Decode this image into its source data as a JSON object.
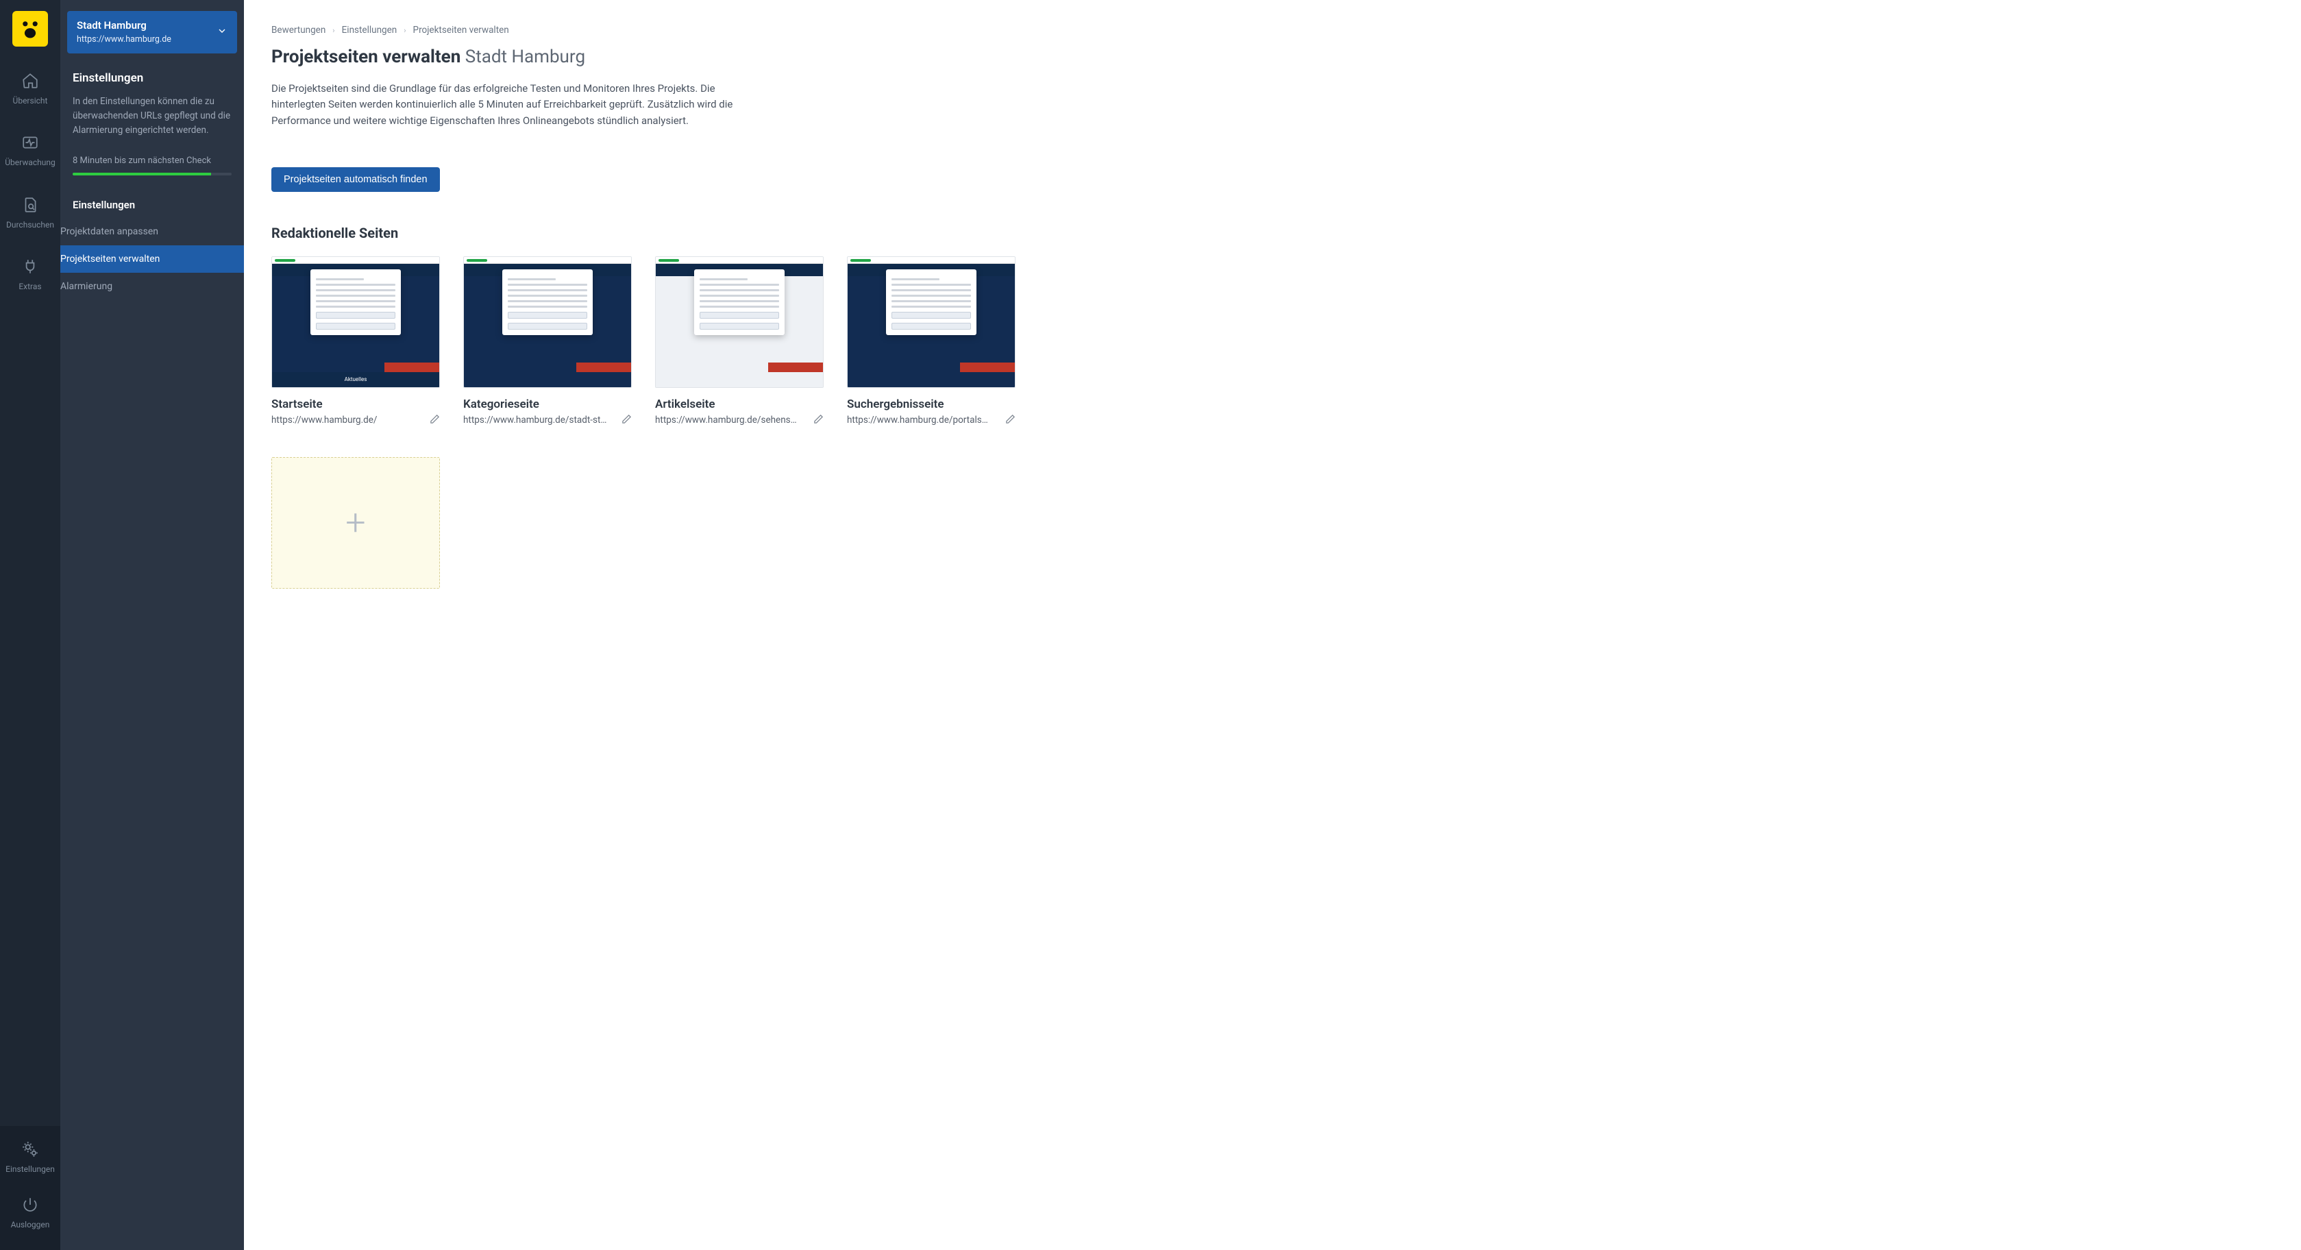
{
  "rail": {
    "items": [
      {
        "id": "overview",
        "label": "Übersicht"
      },
      {
        "id": "monitoring",
        "label": "Überwachung"
      },
      {
        "id": "crawl",
        "label": "Durchsuchen"
      },
      {
        "id": "extras",
        "label": "Extras"
      }
    ],
    "bottom": [
      {
        "id": "settings",
        "label": "Einstellungen"
      },
      {
        "id": "logout",
        "label": "Ausloggen"
      }
    ]
  },
  "project": {
    "name": "Stadt Hamburg",
    "url": "https://www.hamburg.de"
  },
  "side": {
    "heading": "Einstellungen",
    "description": "In den Einstellungen können die zu überwachenden URLs gepflegt und die Alarmierung eingerichtet werden.",
    "checkLine": "8 Minuten bis zum nächsten Check",
    "progressPercent": 87,
    "subHeading": "Einstellungen",
    "menu": [
      {
        "id": "project-data",
        "label": "Projektdaten anpassen",
        "active": false
      },
      {
        "id": "pages",
        "label": "Projektseiten verwalten",
        "active": true
      },
      {
        "id": "alerting",
        "label": "Alarmierung",
        "active": false
      }
    ]
  },
  "breadcrumb": [
    "Bewertungen",
    "Einstellungen",
    "Projektseiten verwalten"
  ],
  "page": {
    "title": "Projektseiten verwalten",
    "titleSuffix": "Stadt Hamburg",
    "intro": "Die Projektseiten sind die Grundlage für das erfolgreiche Testen und Monitoren Ihres Projekts. Die hinterlegten Seiten werden kontinuierlich alle 5 Minuten auf Erreichbarkeit geprüft. Zusätzlich wird die Performance und weitere wichtige Eigenschaften Ihres Onlineangebots stündlich analysiert.",
    "autoFindBtn": "Projektseiten automatisch finden",
    "sectionTitle": "Redaktionelle Seiten"
  },
  "cards": [
    {
      "title": "Startseite",
      "url": "https://www.hamburg.de/",
      "variant": "dark",
      "caption": "Aktuelles"
    },
    {
      "title": "Kategorieseite",
      "url": "https://www.hamburg.de/stadt-staat/",
      "variant": "dark",
      "caption": ""
    },
    {
      "title": "Artikelseite",
      "url": "https://www.hamburg.de/sehenswue…",
      "variant": "light",
      "caption": ""
    },
    {
      "title": "Suchergebnisseite",
      "url": "https://www.hamburg.de/portalsuch…",
      "variant": "dark",
      "caption": ""
    }
  ]
}
